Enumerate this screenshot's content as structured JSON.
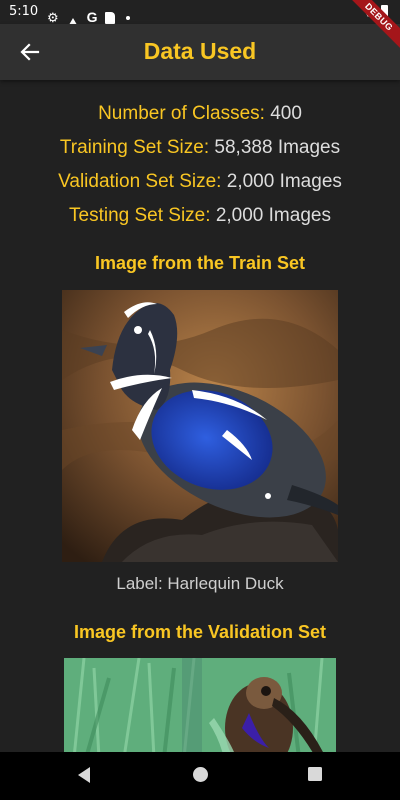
{
  "status_bar": {
    "time": "5:10",
    "icons": [
      "gear-icon",
      "drive-icon",
      "google-icon",
      "sd-card-icon",
      "dot-icon",
      "wifi-icon",
      "battery-icon"
    ],
    "debug_banner": "DEBUG"
  },
  "app_bar": {
    "title": "Data Used",
    "back_icon": "arrow-left-icon",
    "title_color": "#f9c623",
    "background": "#303030"
  },
  "stats": [
    {
      "key": "Number of Classes:",
      "value": "400"
    },
    {
      "key": "Training Set Size:",
      "value": "58,388 Images"
    },
    {
      "key": "Validation Set Size:",
      "value": "2,000 Images"
    },
    {
      "key": "Testing Set Size:",
      "value": "2,000 Images"
    }
  ],
  "train_section": {
    "heading": "Image from the Train Set",
    "label": "Label: Harlequin Duck"
  },
  "validation_section": {
    "heading": "Image from the Validation Set"
  },
  "nav_bar": {
    "icons": [
      "back-triangle-icon",
      "home-circle-icon",
      "recents-square-icon"
    ]
  },
  "colors": {
    "accent": "#f9c623",
    "background": "#212121",
    "text": "#dddddd"
  }
}
